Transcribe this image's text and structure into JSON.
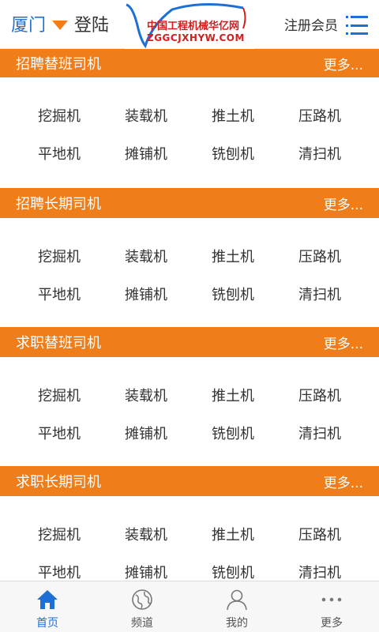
{
  "header": {
    "city": "厦门",
    "login": "登陆",
    "logo_cn": "中国工程机械华亿网",
    "logo_en": "ZGGCJXHYW.COM",
    "register": "注册会员",
    "menu_icon": "list-menu-icon"
  },
  "colors": {
    "accent_orange": "#ef7d1a",
    "link_blue": "#1e6fd6",
    "logo_red": "#d31e1e"
  },
  "sections": [
    {
      "title": "招聘替班司机",
      "more": "更多...",
      "rows": [
        [
          "挖掘机",
          "装载机",
          "推土机",
          "压路机"
        ],
        [
          "平地机",
          "摊铺机",
          "铣刨机",
          "清扫机"
        ]
      ]
    },
    {
      "title": "招聘长期司机",
      "more": "更多...",
      "rows": [
        [
          "挖掘机",
          "装载机",
          "推土机",
          "压路机"
        ],
        [
          "平地机",
          "摊铺机",
          "铣刨机",
          "清扫机"
        ]
      ]
    },
    {
      "title": "求职替班司机",
      "more": "更多...",
      "rows": [
        [
          "挖掘机",
          "装载机",
          "推土机",
          "压路机"
        ],
        [
          "平地机",
          "摊铺机",
          "铣刨机",
          "清扫机"
        ]
      ]
    },
    {
      "title": "求职长期司机",
      "more": "更多...",
      "rows": [
        [
          "挖掘机",
          "装载机",
          "推土机",
          "压路机"
        ],
        [
          "平地机",
          "摊铺机",
          "铣刨机",
          "清扫机"
        ]
      ]
    }
  ],
  "bottom_nav": [
    {
      "label": "首页",
      "icon": "home-icon",
      "active": true
    },
    {
      "label": "频道",
      "icon": "globe-icon",
      "active": false
    },
    {
      "label": "我的",
      "icon": "user-icon",
      "active": false
    },
    {
      "label": "更多",
      "icon": "more-dots-icon",
      "active": false
    }
  ]
}
